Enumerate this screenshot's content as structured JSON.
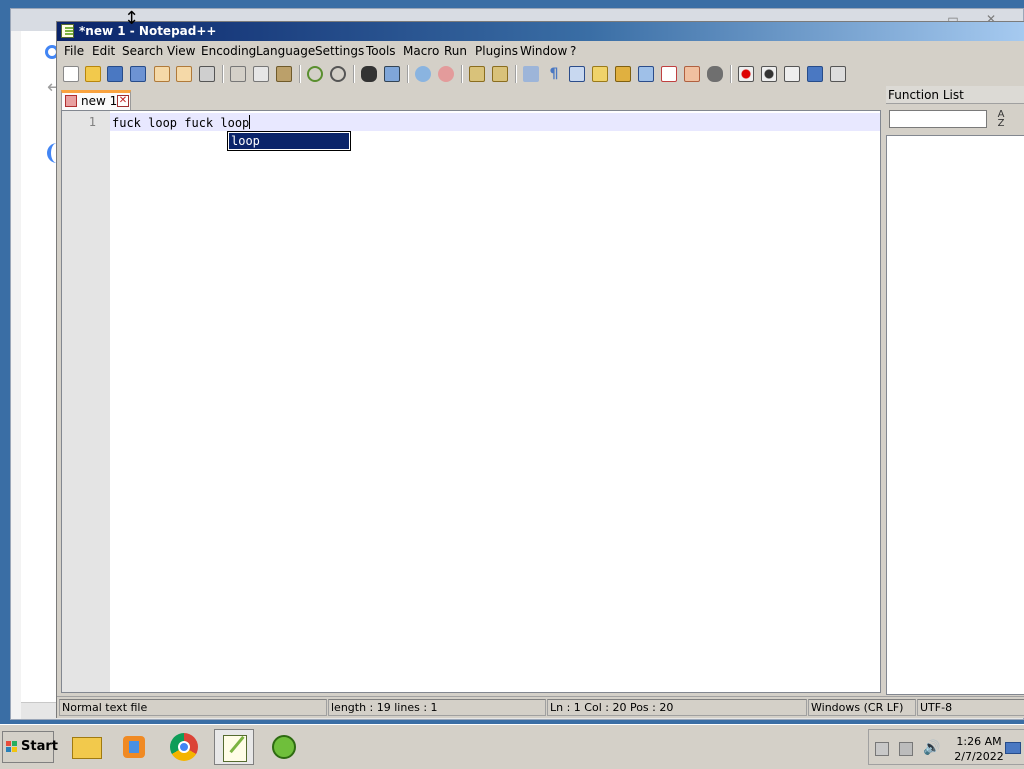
{
  "notepad": {
    "title": "*new 1 - Notepad++",
    "menu": [
      "File",
      "Edit",
      "Search",
      "View",
      "Encoding",
      "Language",
      "Settings",
      "Tools",
      "Macro",
      "Run",
      "Plugins",
      "Window",
      "?"
    ],
    "toolbar_icons": [
      "new-file-icon",
      "open-file-icon",
      "save-icon",
      "save-all-icon",
      "close-icon",
      "close-all-icon",
      "print-icon",
      "cut-icon",
      "copy-icon",
      "paste-icon",
      "undo-icon",
      "redo-icon",
      "find-icon",
      "replace-icon",
      "zoom-in-icon",
      "zoom-out-icon",
      "sync-vertical-icon",
      "sync-horizontal-icon",
      "word-wrap-icon",
      "show-all-chars-icon",
      "indent-guide-icon",
      "user-lang-icon",
      "doc-map-icon",
      "document-list-icon",
      "function-list-icon",
      "folder-workspace-icon",
      "monitoring-icon",
      "record-macro-icon",
      "stop-record-icon",
      "play-macro-icon",
      "run-macro-multiple-icon",
      "save-macro-icon"
    ],
    "tab": {
      "label": "new 1"
    },
    "editor": {
      "line_number": "1",
      "text": "fuck loop fuck loop"
    },
    "autocomplete": {
      "item": "loop"
    },
    "function_list": {
      "title": "Function List",
      "search_value": ""
    },
    "status": {
      "file_type": "Normal text file",
      "length_lines": "length : 19    lines : 1",
      "position": "Ln : 1    Col : 20    Pos : 20",
      "eol": "Windows (CR LF)",
      "encoding": "UTF-8"
    }
  },
  "taskbar": {
    "start_label": "Start",
    "apps": [
      "file-explorer-icon",
      "media-player-icon",
      "chrome-icon",
      "notepad-plus-plus-icon",
      "cygwin-icon"
    ],
    "clock_time": "1:26 AM",
    "clock_date": "2/7/2022"
  },
  "colors": {
    "title_active": "#0a246a",
    "tab_accent": "#f9a33f",
    "selection": "#0a246a",
    "current_line": "#e8e8ff"
  }
}
